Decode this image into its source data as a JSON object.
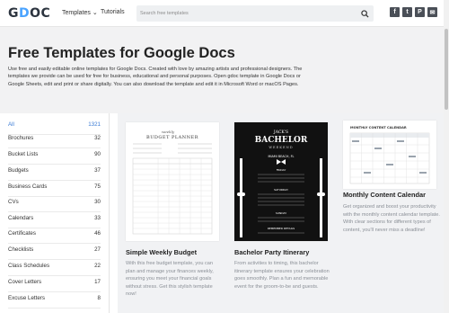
{
  "header": {
    "logo_g": "G",
    "logo_o": "D",
    "logo_rest": "OC",
    "nav": {
      "templates": "Templates ⌄",
      "tutorials": "Tutorials"
    },
    "search_placeholder": "Search free templates",
    "social": [
      "f",
      "t",
      "P",
      "✉"
    ]
  },
  "hero": {
    "title": "Free Templates for Google Docs",
    "description": "Use free and easily editable online templates for Google Docs. Created with love by amazing artists and professional designers. The templates we provide can be used for free for business, educational and personal purposes. Open gdoc template in Google Docs or Google Sheets, edit and print or share digitally. You can also download the template and edit it in Microsoft Word or macOS Pages."
  },
  "sidebar": {
    "categories": [
      {
        "label": "All",
        "count": "1321"
      },
      {
        "label": "Brochures",
        "count": "32"
      },
      {
        "label": "Bucket Lists",
        "count": "90"
      },
      {
        "label": "Budgets",
        "count": "37"
      },
      {
        "label": "Business Cards",
        "count": "75"
      },
      {
        "label": "CVs",
        "count": "30"
      },
      {
        "label": "Calendars",
        "count": "33"
      },
      {
        "label": "Certificates",
        "count": "46"
      },
      {
        "label": "Checklists",
        "count": "27"
      },
      {
        "label": "Class Schedules",
        "count": "22"
      },
      {
        "label": "Cover Letters",
        "count": "17"
      },
      {
        "label": "Excuse Letters",
        "count": "8"
      }
    ]
  },
  "cards": [
    {
      "title": "Simple Weekly Budget",
      "description": "With this free budget template, you can plan and manage your finances weekly, ensuring you meet your financial goals without stress. Get this stylish template now!",
      "thumb_heading": "BUDGET PLANNER",
      "thumb_script": "weekly"
    },
    {
      "title": "Bachelor Party Itinerary",
      "description": "From activities to timing, this bachelor itinerary template ensures your celebration goes smoothly. Plan a fun and memorable event for the groom-to-be and guests.",
      "thumb_name": "JACK'S",
      "thumb_heading": "BACHELOR",
      "thumb_sub": "WEEKEND",
      "thumb_location": "MIAMI BEACH, FL",
      "thumb_days": [
        "FRIDAY",
        "SATURDAY",
        "SUNDAY"
      ],
      "thumb_footer": "REMEMBER DETAILS"
    },
    {
      "title": "Monthly Content Calendar",
      "description": "Get organized and boost your productivity with the monthly content calendar template. With clear sections for different types of content, you'll never miss a deadline!",
      "thumb_heading": "MONTHLY CONTENT CALENDAR"
    }
  ],
  "colors": {
    "accent": "#3a7bd5",
    "logo_accent": "#4aa3ff",
    "card_bg": "#f1f2f4",
    "hero_bg": "#f2f2f3",
    "dark_thumb": "#111111"
  }
}
